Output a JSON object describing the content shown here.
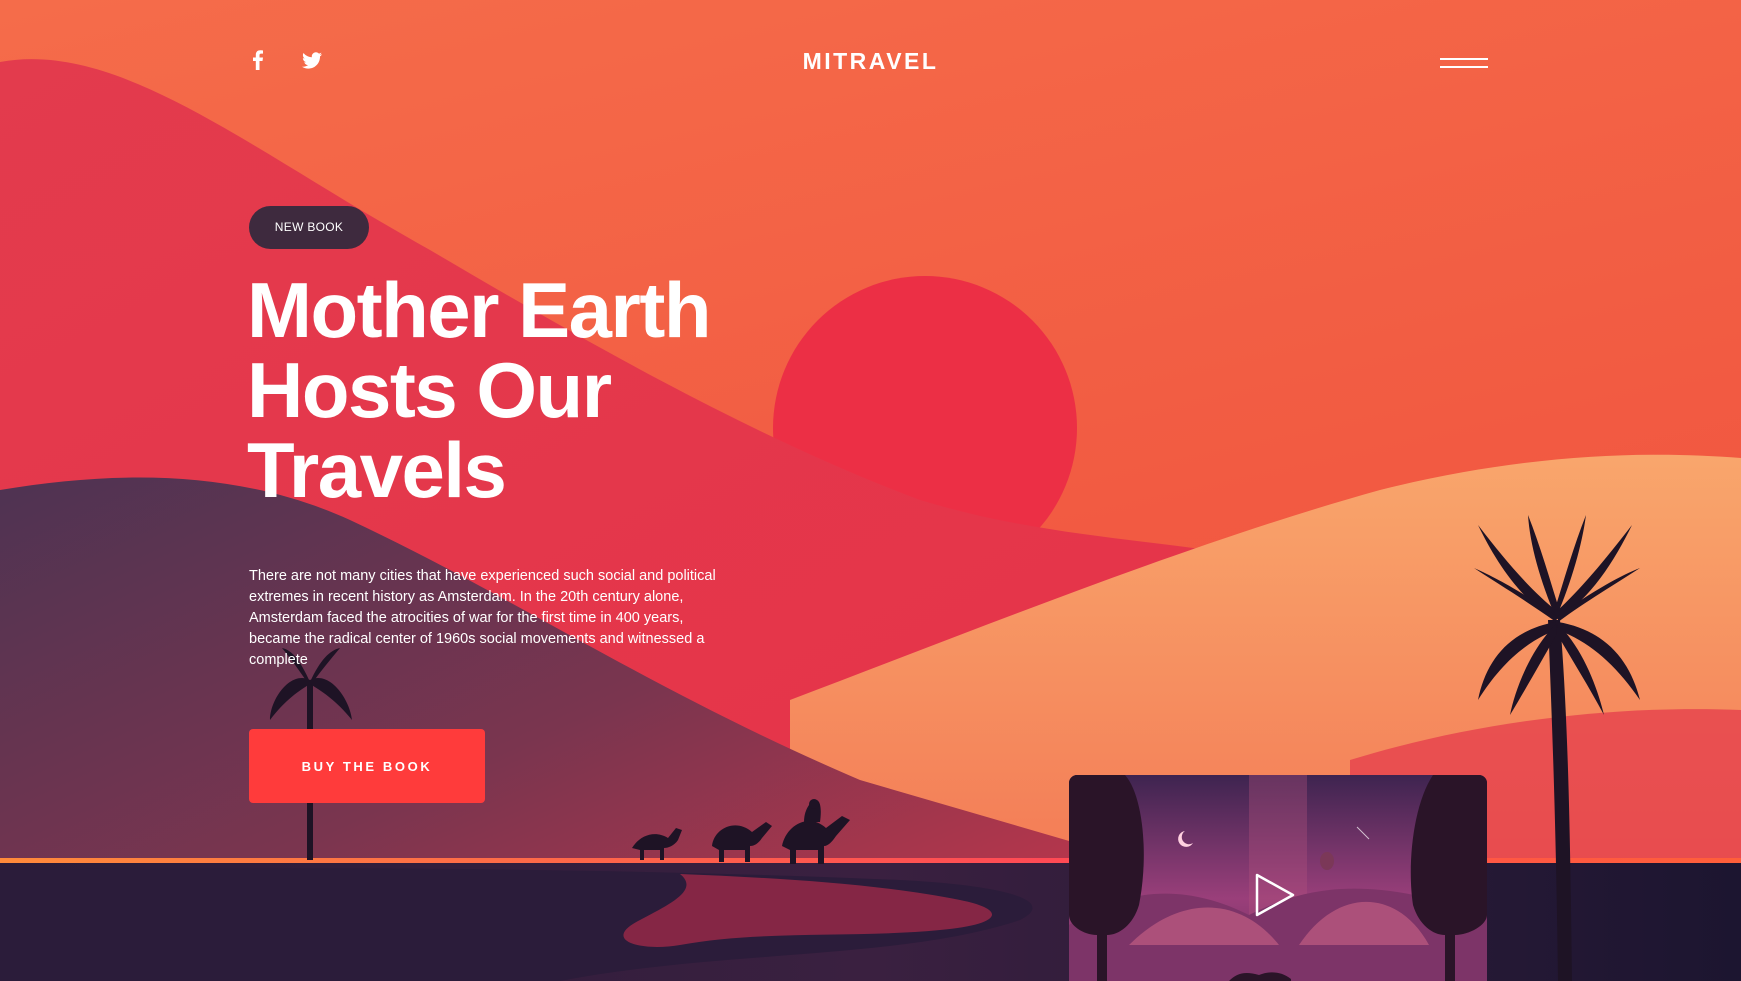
{
  "brand": {
    "name": "MITRAVEL"
  },
  "header": {
    "social": [
      {
        "network": "Facebook",
        "icon": "facebook-icon"
      },
      {
        "network": "Twitter",
        "icon": "twitter-icon"
      }
    ],
    "menu_icon": "hamburger-menu-icon"
  },
  "hero": {
    "badge": "NEW BOOK",
    "title_lines": [
      "Mother Earth",
      "Hosts Our",
      "Travels"
    ],
    "description": "There are not many cities that have experienced such social and political extremes in recent history as Amsterdam. In the 20th century alone, Amsterdam faced the atrocities of war for the first time in 400 years, became the radical center of 1960s social movements and witnessed a complete",
    "cta_label": "BUY THE BOOK"
  },
  "video": {
    "play_icon": "play-icon"
  },
  "colors": {
    "sky": "#f26b48",
    "sun": "#ec2f45",
    "badge": "#3e2a3e",
    "cta": "#ff3b3b",
    "text": "#ffffff",
    "water": "#1f1733"
  }
}
